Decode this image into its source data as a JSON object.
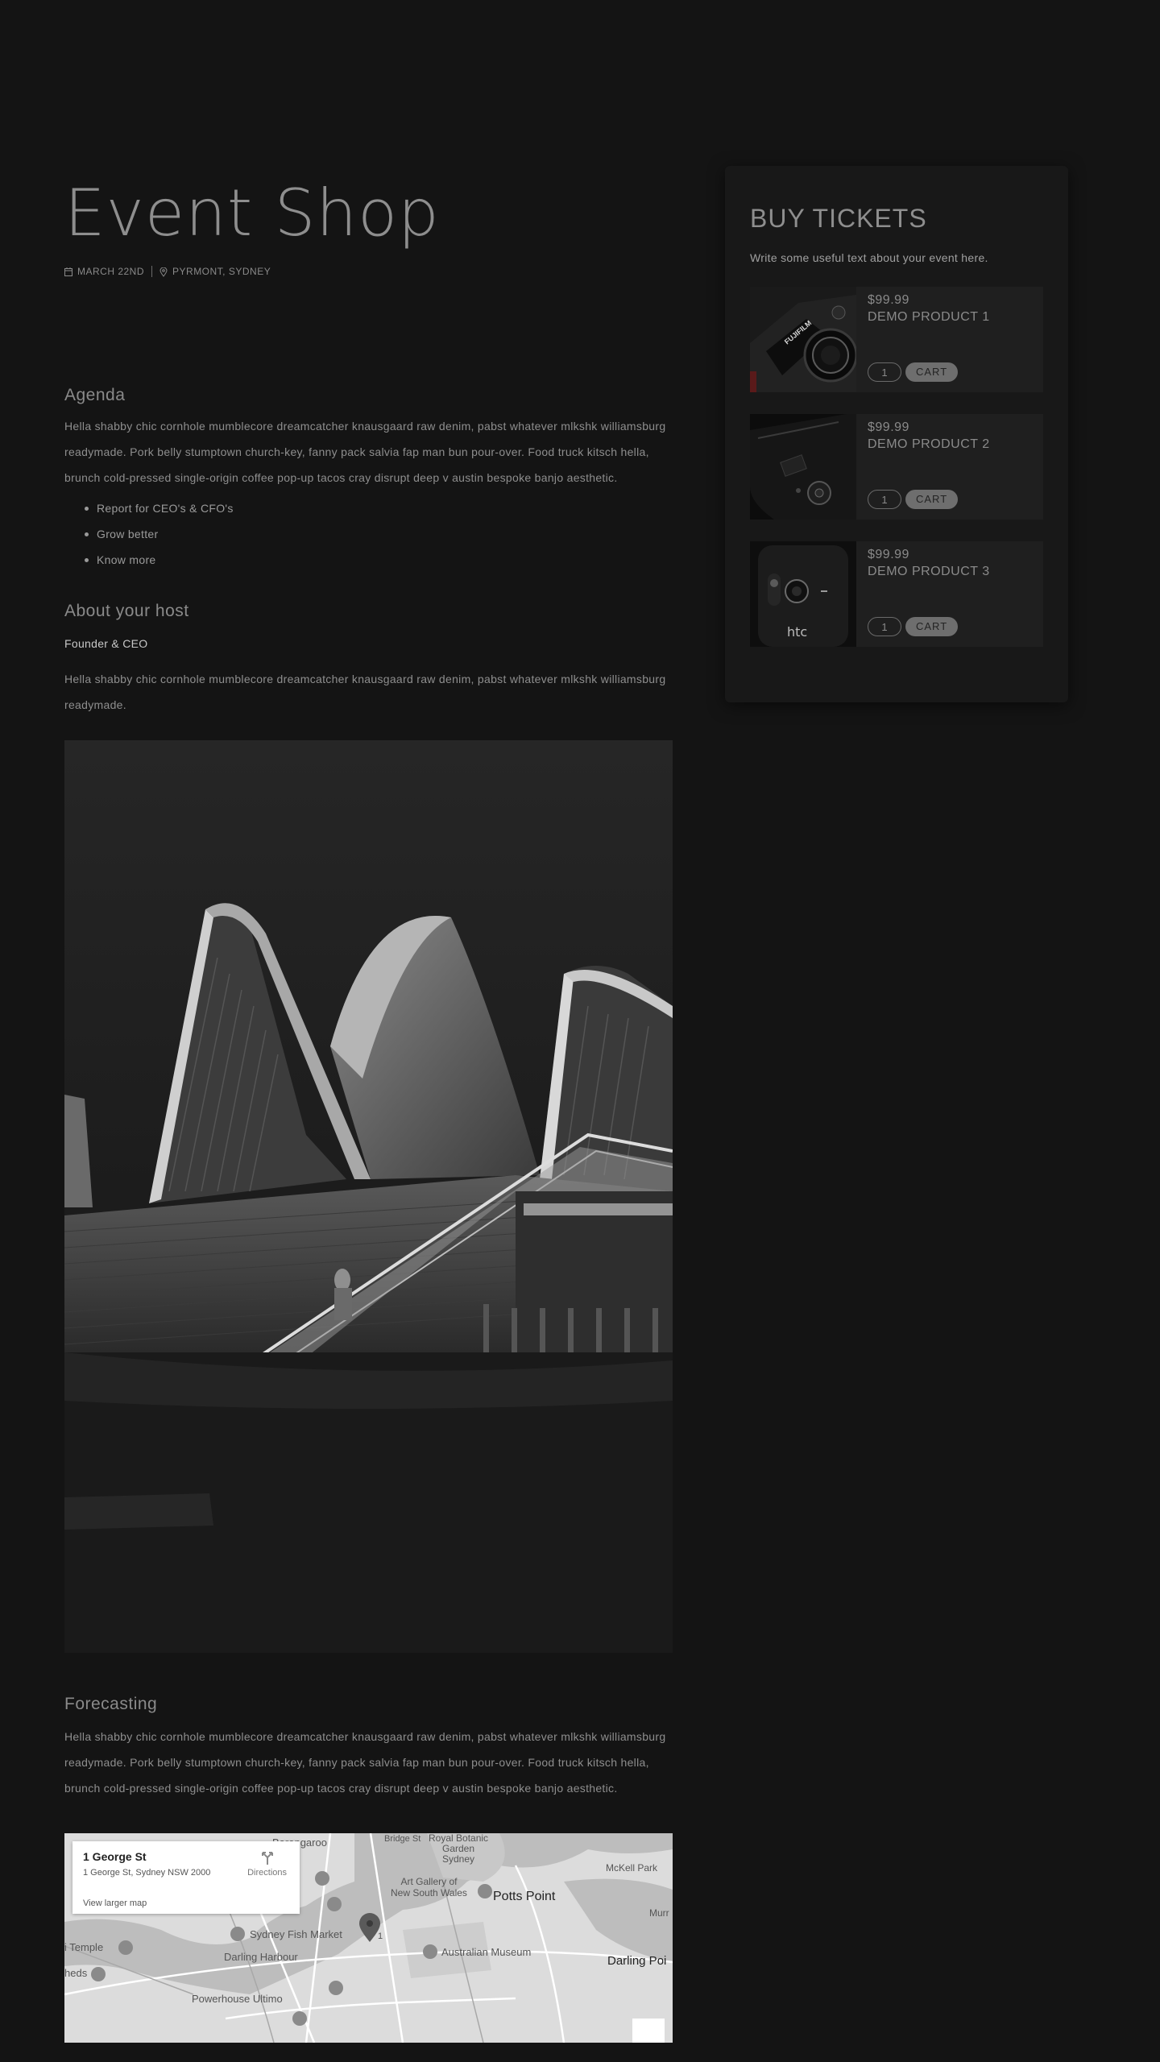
{
  "event": {
    "title": "Event Shop",
    "date": "MARCH 22ND",
    "location": "PYRMONT, SYDNEY"
  },
  "agenda": {
    "heading": "Agenda",
    "text": "Hella shabby chic cornhole mumblecore dreamcatcher knausgaard raw denim, pabst whatever mlkshk williamsburg readymade. Pork belly stumptown church-key, fanny pack salvia fap man bun pour-over. Food truck kitsch hella, brunch cold-pressed single-origin coffee pop-up tacos cray disrupt deep v austin bespoke banjo aesthetic.",
    "items": [
      "Report for CEO's & CFO's",
      "Grow better",
      "Know more"
    ]
  },
  "host": {
    "heading": "About your host",
    "role": "Founder & CEO",
    "text": "Hella shabby chic cornhole mumblecore dreamcatcher knausgaard raw denim, pabst whatever mlkshk williamsburg readymade."
  },
  "forecast": {
    "heading": "Forecasting",
    "text": "Hella shabby chic cornhole mumblecore dreamcatcher knausgaard raw denim, pabst whatever mlkshk williamsburg readymade. Pork belly stumptown church-key, fanny pack salvia fap man bun pour-over. Food truck kitsch hella, brunch cold-pressed single-origin coffee pop-up tacos cray disrupt deep v austin bespoke banjo aesthetic."
  },
  "map": {
    "place_name": "1 George St",
    "address": "1 George St, Sydney NSW 2000",
    "directions_label": "Directions",
    "larger_map_label": "View larger map",
    "labels": {
      "barangaroo": "Barangaroo",
      "bridge_st": "Bridge St",
      "botanic": "Royal Botanic\nGarden\nSydney",
      "mckell": "McKell Park",
      "art_gallery": "Art Gallery of\nNew South Wales",
      "potts_point": "Potts Point",
      "murr": "Murr",
      "fish_market": "Sydney Fish Market",
      "temple": "i Temple",
      "darling_harbour": "Darling Harbour",
      "australian_museum": "Australian Museum",
      "darling_point": "Darling Poi",
      "heds": "heds",
      "powerhouse": "Powerhouse Ultimo",
      "marker_number": "1"
    }
  },
  "sidebar": {
    "title": "BUY TICKETS",
    "text": "Write some useful text about your event here.",
    "products": [
      {
        "price": "$99.99",
        "name": "DEMO PRODUCT 1",
        "qty": "1",
        "cart_label": "CART"
      },
      {
        "price": "$99.99",
        "name": "DEMO PRODUCT 2",
        "qty": "1",
        "cart_label": "CART"
      },
      {
        "price": "$99.99",
        "name": "DEMO PRODUCT 3",
        "qty": "1",
        "cart_label": "CART"
      }
    ]
  },
  "image_lettering": {
    "camera_brand": "FUJIFILM",
    "phone_brand": "htc"
  }
}
